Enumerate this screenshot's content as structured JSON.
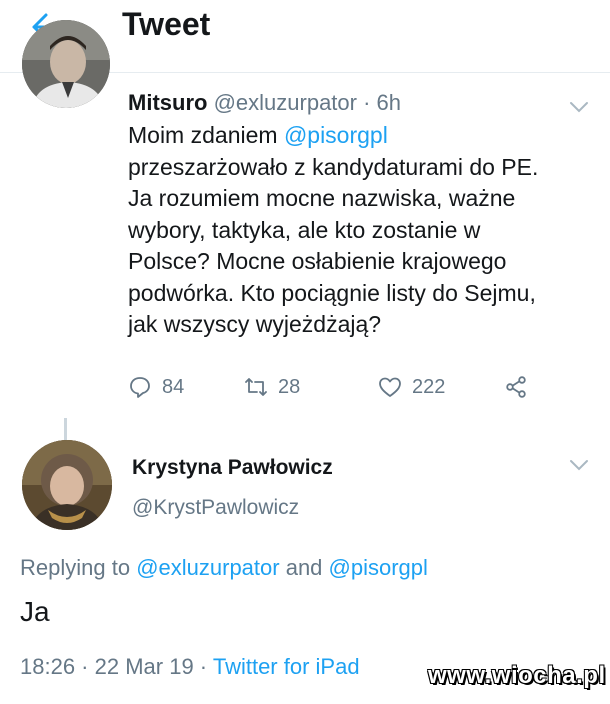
{
  "header": {
    "title": "Tweet",
    "back_icon": "arrow-left-icon"
  },
  "tweet": {
    "display_name": "Mitsuro",
    "handle": "@exluzurpator",
    "separator": " · ",
    "time": "6h",
    "text_before_mention": "Moim zdaniem ",
    "mention": "@pisorgpl",
    "text_after_mention": "\nprzeszarżowało z kandydaturami do PE.\nJa rozumiem mocne nazwiska, ważne\nwybory, taktyka, ale kto zostanie w\nPolsce? Mocne osłabienie krajowego\npodwórka. Kto pociągnie listy do Sejmu,\njak wszyscy wyjeżdżają?",
    "stats": {
      "replies": "84",
      "retweets": "28",
      "likes": "222"
    }
  },
  "reply": {
    "display_name": "Krystyna Pawłowicz",
    "handle": "@KrystPawlowicz",
    "replying_prefix": "Replying to ",
    "replying_user1": "@exluzurpator",
    "replying_and": " and ",
    "replying_user2": "@pisorgpl",
    "text": "Ja",
    "time": "18:26",
    "separator": " · ",
    "date": "22 Mar 19",
    "source": "Twitter for iPad"
  },
  "watermark": "www.wiocha.pl",
  "colors": {
    "link": "#1da1f2",
    "muted": "#657786",
    "text": "#14171a"
  }
}
